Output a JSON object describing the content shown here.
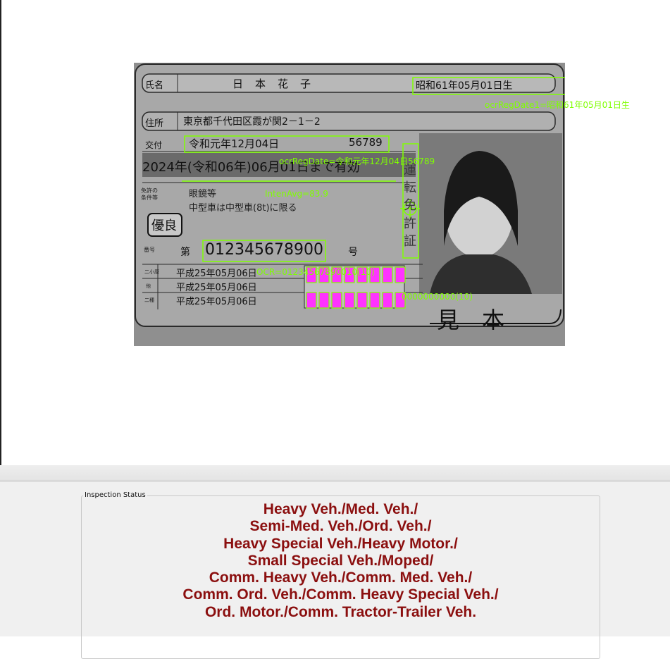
{
  "card": {
    "name_label": "氏名",
    "name_value": "日　本　花　子",
    "birth_date": "昭和61年05月01日生",
    "address_label": "住所",
    "address_value": "東京都千代田区霞が関2－1－2",
    "issue_label": "交付",
    "issue_date": "令和元年12月04日",
    "issue_number": "56789",
    "expiry": "2024年(令和06年)06月01日まで有効",
    "conditions_label_1": "免許の",
    "conditions_label_2": "条件等",
    "conditions_line_1": "眼鏡等",
    "conditions_line_2": "中型車は中型車(8t)に限る",
    "excellent_badge": "優良",
    "number_label": "番号",
    "number_prefix": "第",
    "license_number": "012345678900",
    "number_suffix": "号",
    "class_rows": [
      {
        "label": "二小原",
        "date": "平成25年05月06日"
      },
      {
        "label": "他",
        "date": "平成25年05月06日"
      },
      {
        "label": "二種",
        "date": "平成25年05月06日"
      }
    ],
    "side_text": "運転免許証",
    "specimen_text": "見　本"
  },
  "overlays": {
    "ocr_reg_date1": "ocrRegDate1=昭和61年05月01日生",
    "ocr_reg_date": "ocrRegDate=令和元年12月04日56789",
    "inten_avg": "IntenAvg=83.9",
    "ocr_line_1": "OCR=01234567890010(10)",
    "ocr_line_2": "0000000000(10)"
  },
  "status": {
    "legend": "Inspection Status",
    "lines": [
      "Heavy Veh./Med. Veh./",
      "Semi-Med. Veh./Ord. Veh./",
      "Heavy Special Veh./Heavy Motor./",
      "Small Special Veh./Moped/",
      "Comm. Heavy Veh./Comm. Med. Veh./",
      "Comm. Ord. Veh./Comm. Heavy Special Veh./",
      "Ord. Motor./Comm. Tractor-Trailer Veh."
    ]
  },
  "colors": {
    "overlay_green": "#7fff00",
    "status_text": "#8b0f0f"
  }
}
